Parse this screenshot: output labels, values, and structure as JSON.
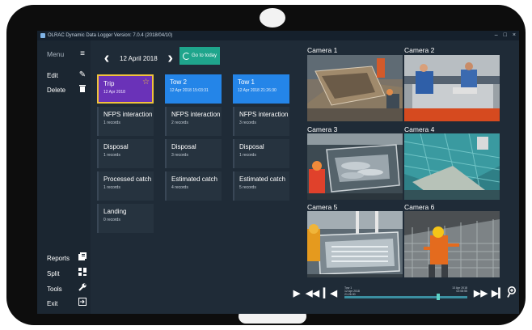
{
  "window": {
    "title": "OLRAC Dynamic Data Logger Version: 7.0.4 (2018/04/10)",
    "controls": [
      "–",
      "□",
      "×"
    ]
  },
  "sidebar": {
    "menu_label": "Menu",
    "items": [
      {
        "label": "Edit",
        "icon": "pencil-icon"
      },
      {
        "label": "Delete",
        "icon": "trash-icon"
      },
      {
        "label": "Reports",
        "icon": "reports-icon"
      },
      {
        "label": "Split",
        "icon": "split-icon"
      },
      {
        "label": "Tools",
        "icon": "wrench-icon"
      },
      {
        "label": "Exit",
        "icon": "exit-icon"
      }
    ]
  },
  "date_nav": {
    "date": "12 April 2018",
    "go_to_today": "Go to today"
  },
  "columns": [
    {
      "header": {
        "title": "Trip",
        "subtitle": "12 Apr 2018",
        "style": "trip"
      },
      "tiles": [
        {
          "title": "NFPS interaction",
          "subtitle": "1 records"
        },
        {
          "title": "Disposal",
          "subtitle": "1 records"
        },
        {
          "title": "Processed catch",
          "subtitle": "1 records"
        },
        {
          "title": "Landing",
          "subtitle": "0 records"
        }
      ]
    },
    {
      "header": {
        "title": "Tow 2",
        "subtitle": "12 Apr 2018 15:03:31",
        "style": "blue"
      },
      "tiles": [
        {
          "title": "NFPS interaction",
          "subtitle": "2 records"
        },
        {
          "title": "Disposal",
          "subtitle": "3 records"
        },
        {
          "title": "Estimated catch",
          "subtitle": "4 records"
        }
      ]
    },
    {
      "header": {
        "title": "Tow 1",
        "subtitle": "12 Apr 2018 21:26:30",
        "style": "blue"
      },
      "tiles": [
        {
          "title": "NFPS interaction",
          "subtitle": "3 records"
        },
        {
          "title": "Disposal",
          "subtitle": "1 records"
        },
        {
          "title": "Estimated catch",
          "subtitle": "5 records"
        }
      ]
    }
  ],
  "cameras": [
    "Camera 1",
    "Camera 2",
    "Camera 3",
    "Camera 4",
    "Camera 5",
    "Camera 6"
  ],
  "player": {
    "left_info": [
      "Tow 1",
      "12 Apr 2018",
      "21:26:30"
    ],
    "right_info": [
      "13 Apr 2018",
      "02:08:55"
    ],
    "position": 0.76
  },
  "colors": {
    "accent_blue": "#2485e8",
    "trip_purple": "#6a32b8",
    "trip_border": "#f0c23c",
    "go_today_green": "#1fa58c"
  }
}
